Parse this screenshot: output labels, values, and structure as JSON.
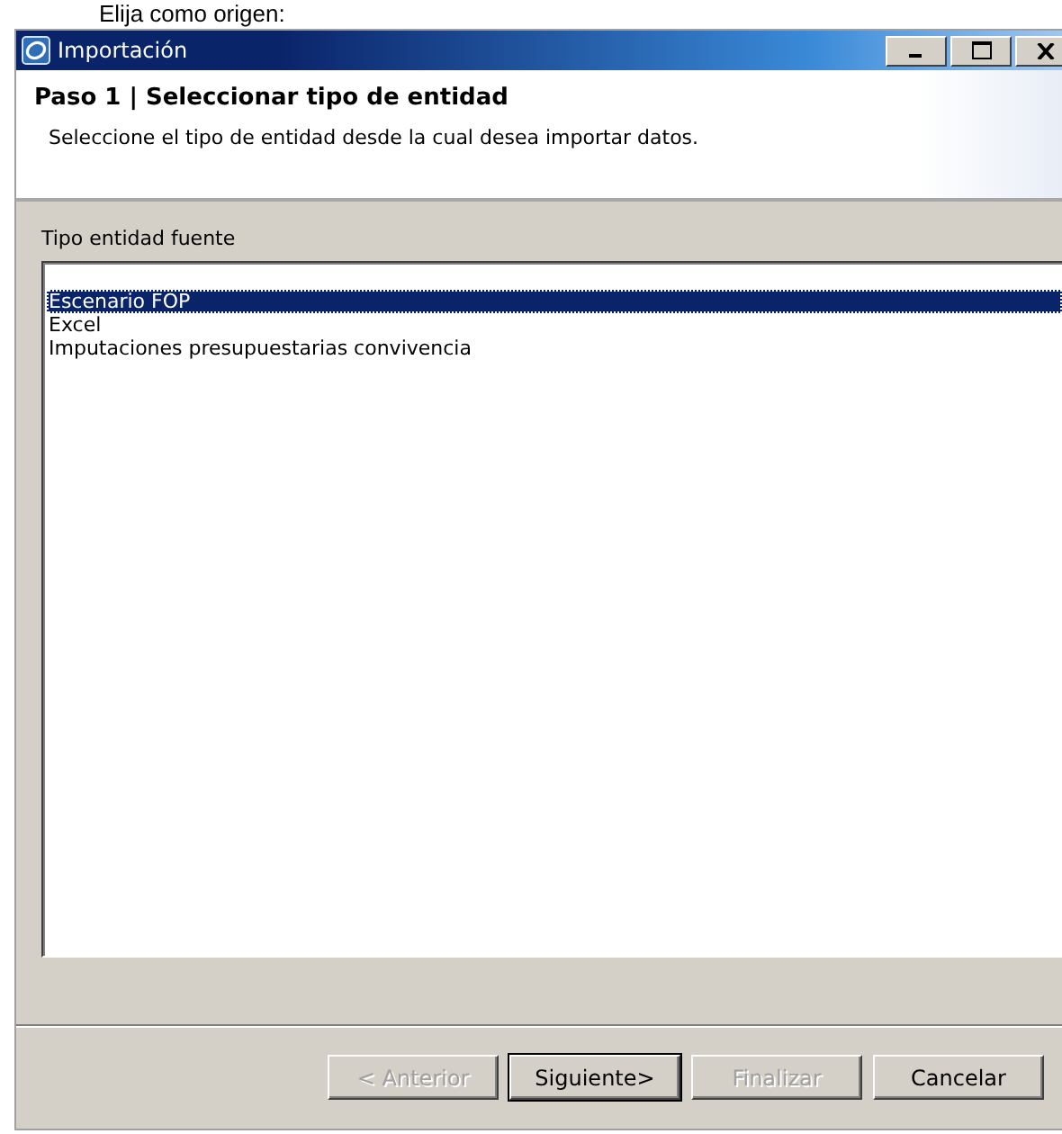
{
  "caption": "Elija como origen:",
  "window": {
    "title": "Importación"
  },
  "header": {
    "title": "Paso 1 | Seleccionar tipo de entidad",
    "description": "Seleccione el tipo de entidad desde la cual desea importar datos."
  },
  "source_list": {
    "label": "Tipo entidad fuente",
    "items": [
      {
        "label": "Escenario FOP",
        "selected": true
      },
      {
        "label": "Excel",
        "selected": false
      },
      {
        "label": "Imputaciones presupuestarias convivencia",
        "selected": false
      }
    ]
  },
  "buttons": [
    {
      "label": "< Anterior",
      "disabled": true,
      "default": false
    },
    {
      "label": "Siguiente>",
      "disabled": false,
      "default": true
    },
    {
      "label": "Finalizar",
      "disabled": true,
      "default": false
    },
    {
      "label": "Cancelar",
      "disabled": false,
      "default": false
    }
  ]
}
